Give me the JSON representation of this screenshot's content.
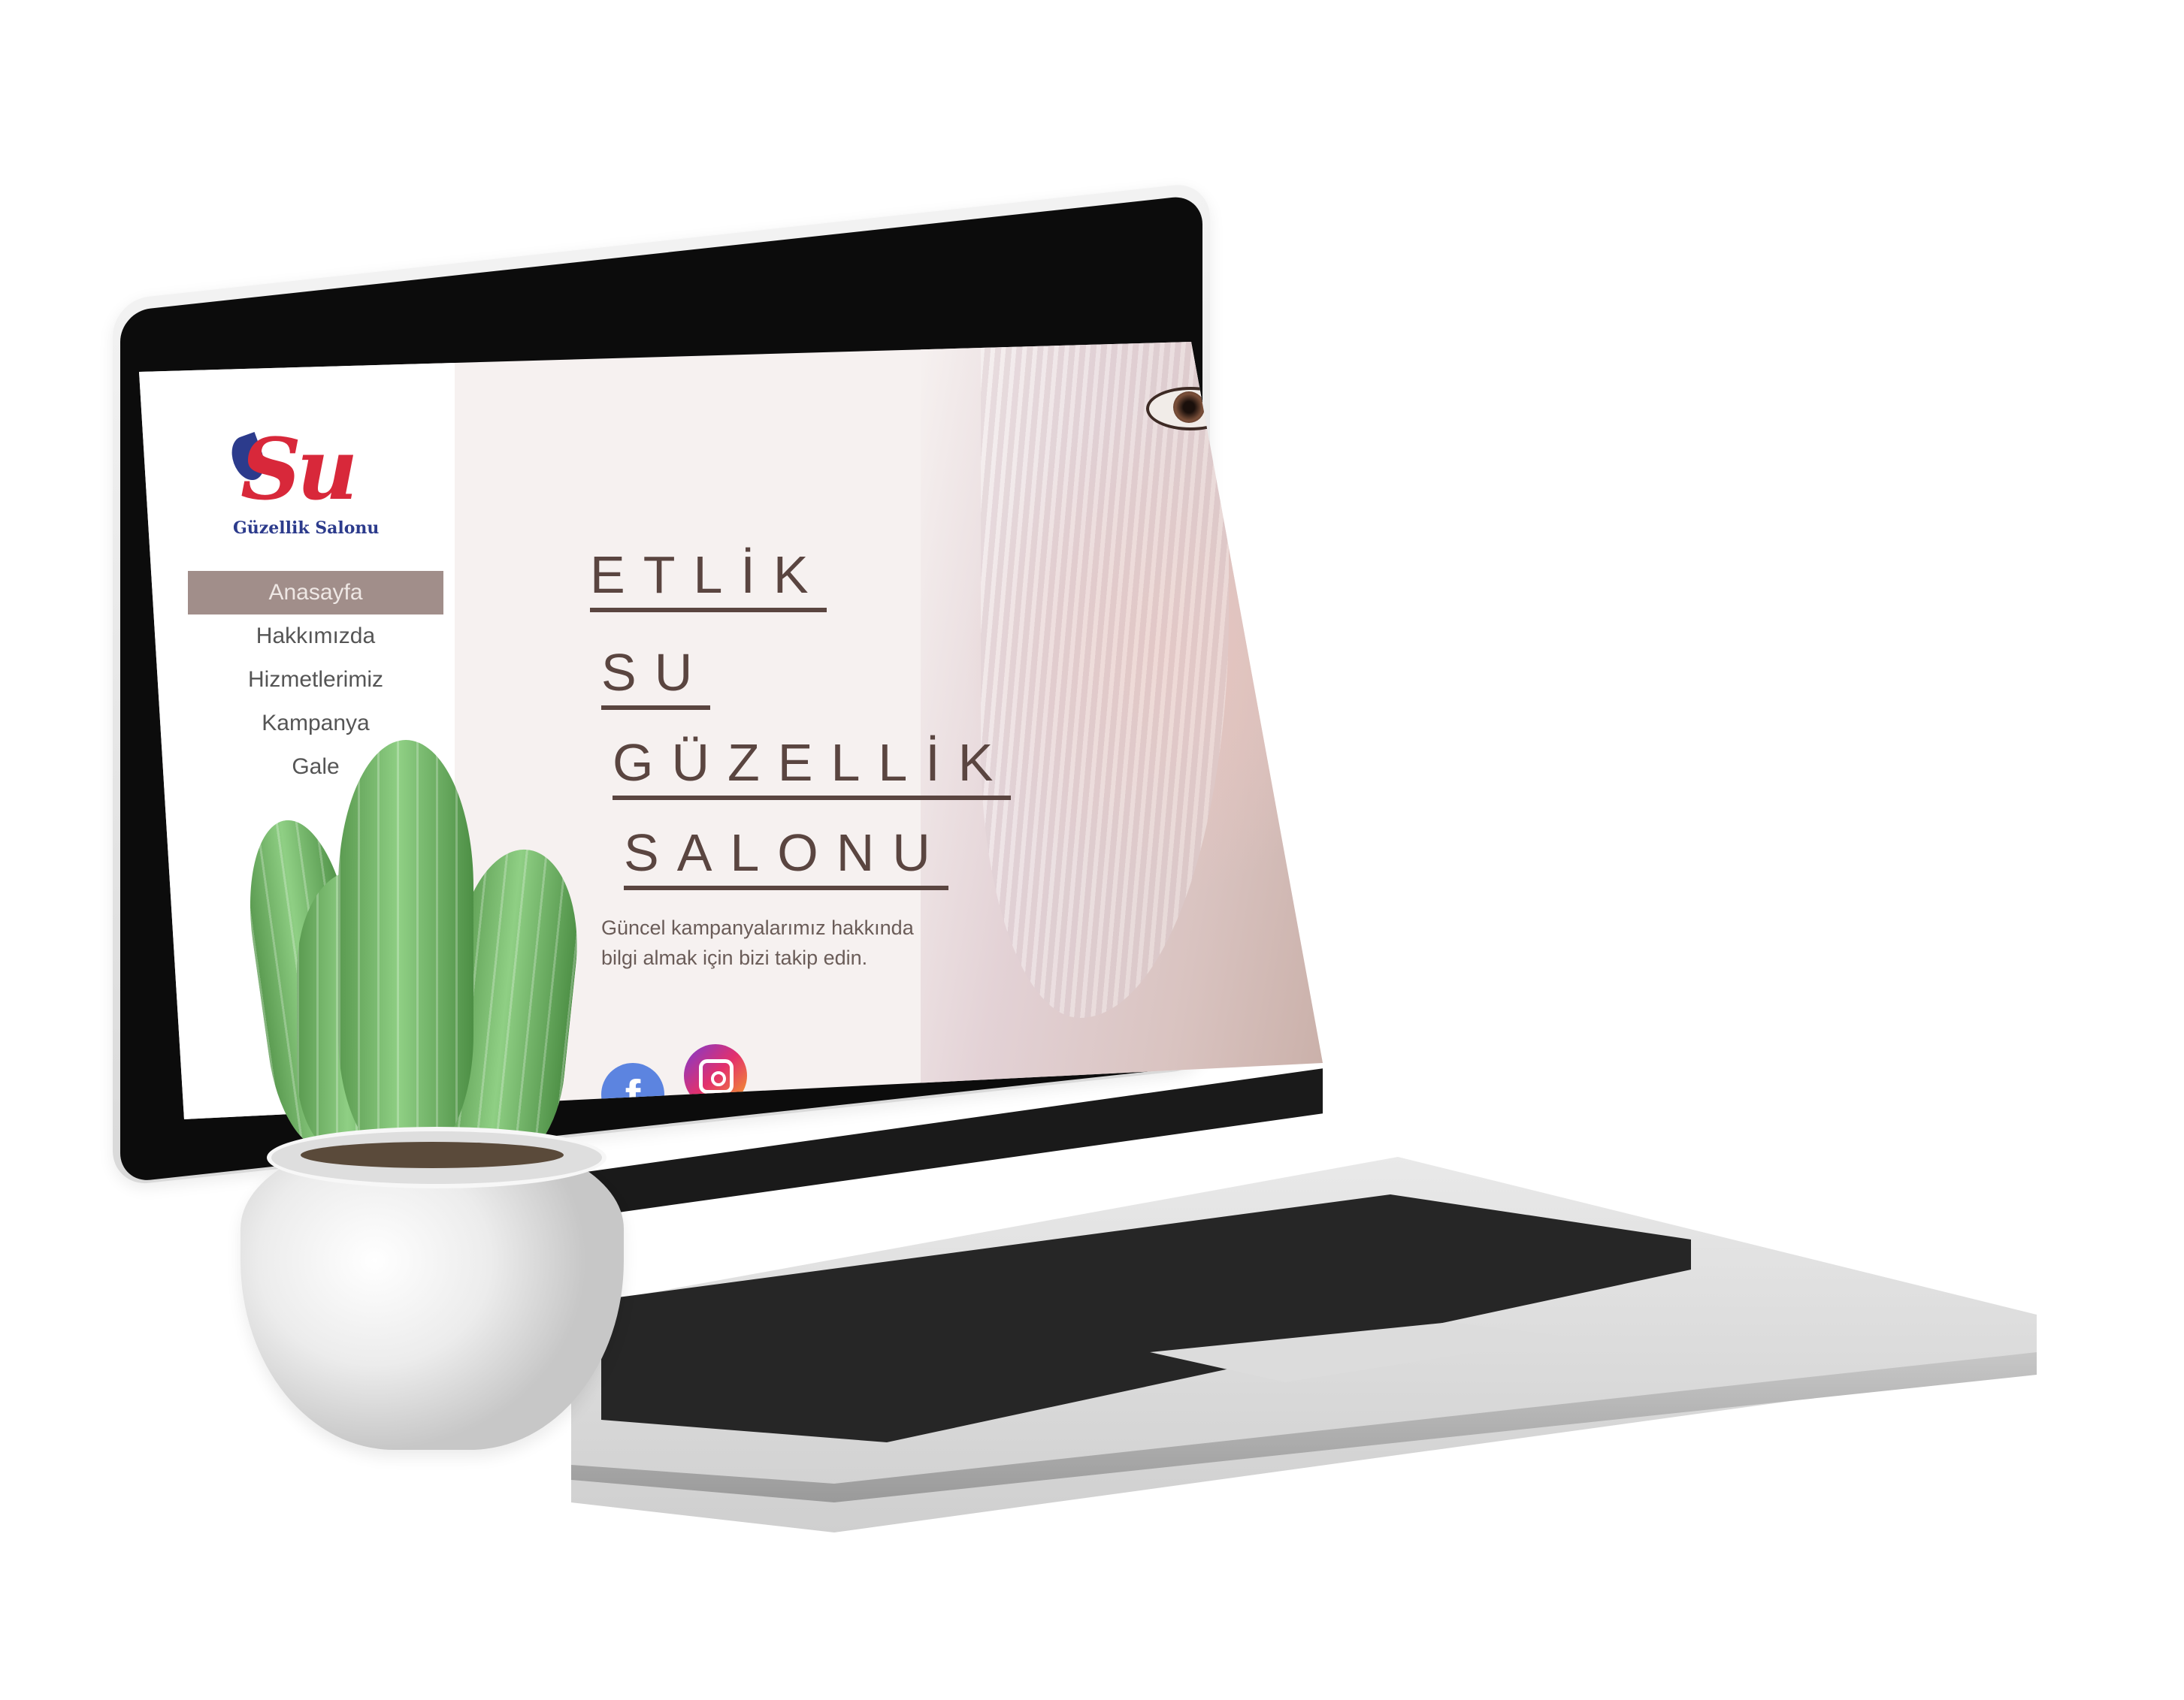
{
  "site": {
    "logo": {
      "mark": "Su",
      "name": "Güzellik Salonu"
    },
    "nav": [
      {
        "label": "Anasayfa",
        "active": true
      },
      {
        "label": "Hakkımızda",
        "active": false
      },
      {
        "label": "Hizmetlerimiz",
        "active": false
      },
      {
        "label": "Kampanya",
        "active": false
      },
      {
        "label": "Gale",
        "active": false
      }
    ],
    "hero": {
      "title_lines": [
        "ETLİK",
        "SU",
        "GÜZELLİK",
        "SALONU"
      ],
      "subtitle_line1": "Güncel kampanyalarımız hakkında",
      "subtitle_line2": "bilgi almak için bizi takip edin."
    },
    "social": [
      {
        "name": "facebook-icon",
        "glyph": "f"
      },
      {
        "name": "instagram-icon"
      }
    ]
  },
  "colors": {
    "accent_nav": "#a18e8a",
    "title_text": "#5a4540",
    "logo_red": "#d8283a",
    "logo_blue": "#2c3b8c",
    "facebook": "#5c84e0"
  }
}
